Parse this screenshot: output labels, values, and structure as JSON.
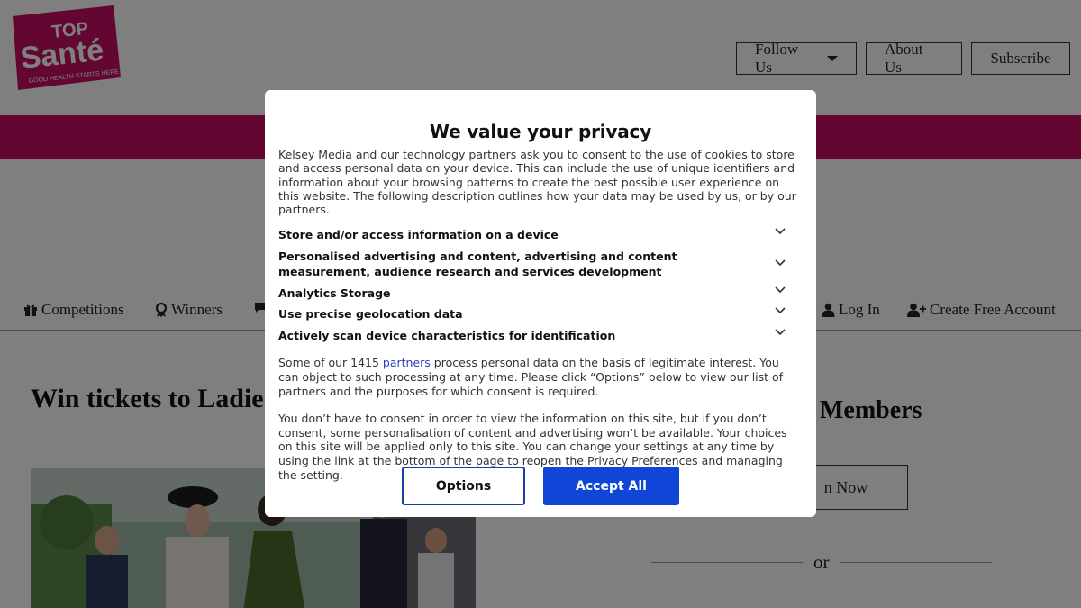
{
  "header": {
    "logo": {
      "top": "TOP",
      "main": "Santé",
      "tagline": "GOOD HEALTH STARTS HERE"
    },
    "buttons": {
      "follow": "Follow Us",
      "about": "About Us",
      "subscribe": "Subscribe"
    }
  },
  "nav": {
    "items": [
      {
        "label": "Competitions",
        "icon": "gift-icon"
      },
      {
        "label": "Winners",
        "icon": "award-icon"
      },
      {
        "label": "",
        "icon": "chat-icon"
      },
      {
        "label": "Log In",
        "icon": "user-icon"
      },
      {
        "label": "Create Free Account",
        "icon": "user-plus-icon"
      }
    ]
  },
  "article": {
    "title": "Win tickets to Ladie Racecourse"
  },
  "sidebar": {
    "members_heading": "Members",
    "join_label": "n Now",
    "or_text": "or"
  },
  "colors": {
    "brand_pink": "#c80d64",
    "accept_blue": "#0f46d8",
    "options_border": "#1a3ea8"
  },
  "privacy": {
    "title": "We value your privacy",
    "intro": "Kelsey Media and our technology partners ask you to consent to the use of cookies to store and access personal data on your device. This can include the use of unique identifiers and information about your browsing patterns to create the best possible user experience on this website. The following description outlines how your data may be used by us, or by our partners.",
    "purposes": [
      "Store and/or access information on a device",
      "Personalised advertising and content, advertising and content measurement, audience research and services development",
      "Analytics Storage",
      "Use precise geolocation data",
      "Actively scan device characteristics for identification"
    ],
    "legit_prefix": "Some of our 1415 ",
    "legit_link": "partners",
    "legit_suffix": " process personal data on the basis of legitimate interest. You can object to such processing at any time. Please click “Options” below to view our list of partners and the purposes for which consent is required.",
    "consent_note": "You don’t have to consent in order to view the information on this site, but if you don’t consent, some personalisation of content and advertising won’t be available. Your choices on this site will be applied only to this site. You can change your settings at any time by using the link at the bottom of the page to reopen the Privacy Preferences and managing the setting.",
    "options_label": "Options",
    "accept_label": "Accept All"
  }
}
